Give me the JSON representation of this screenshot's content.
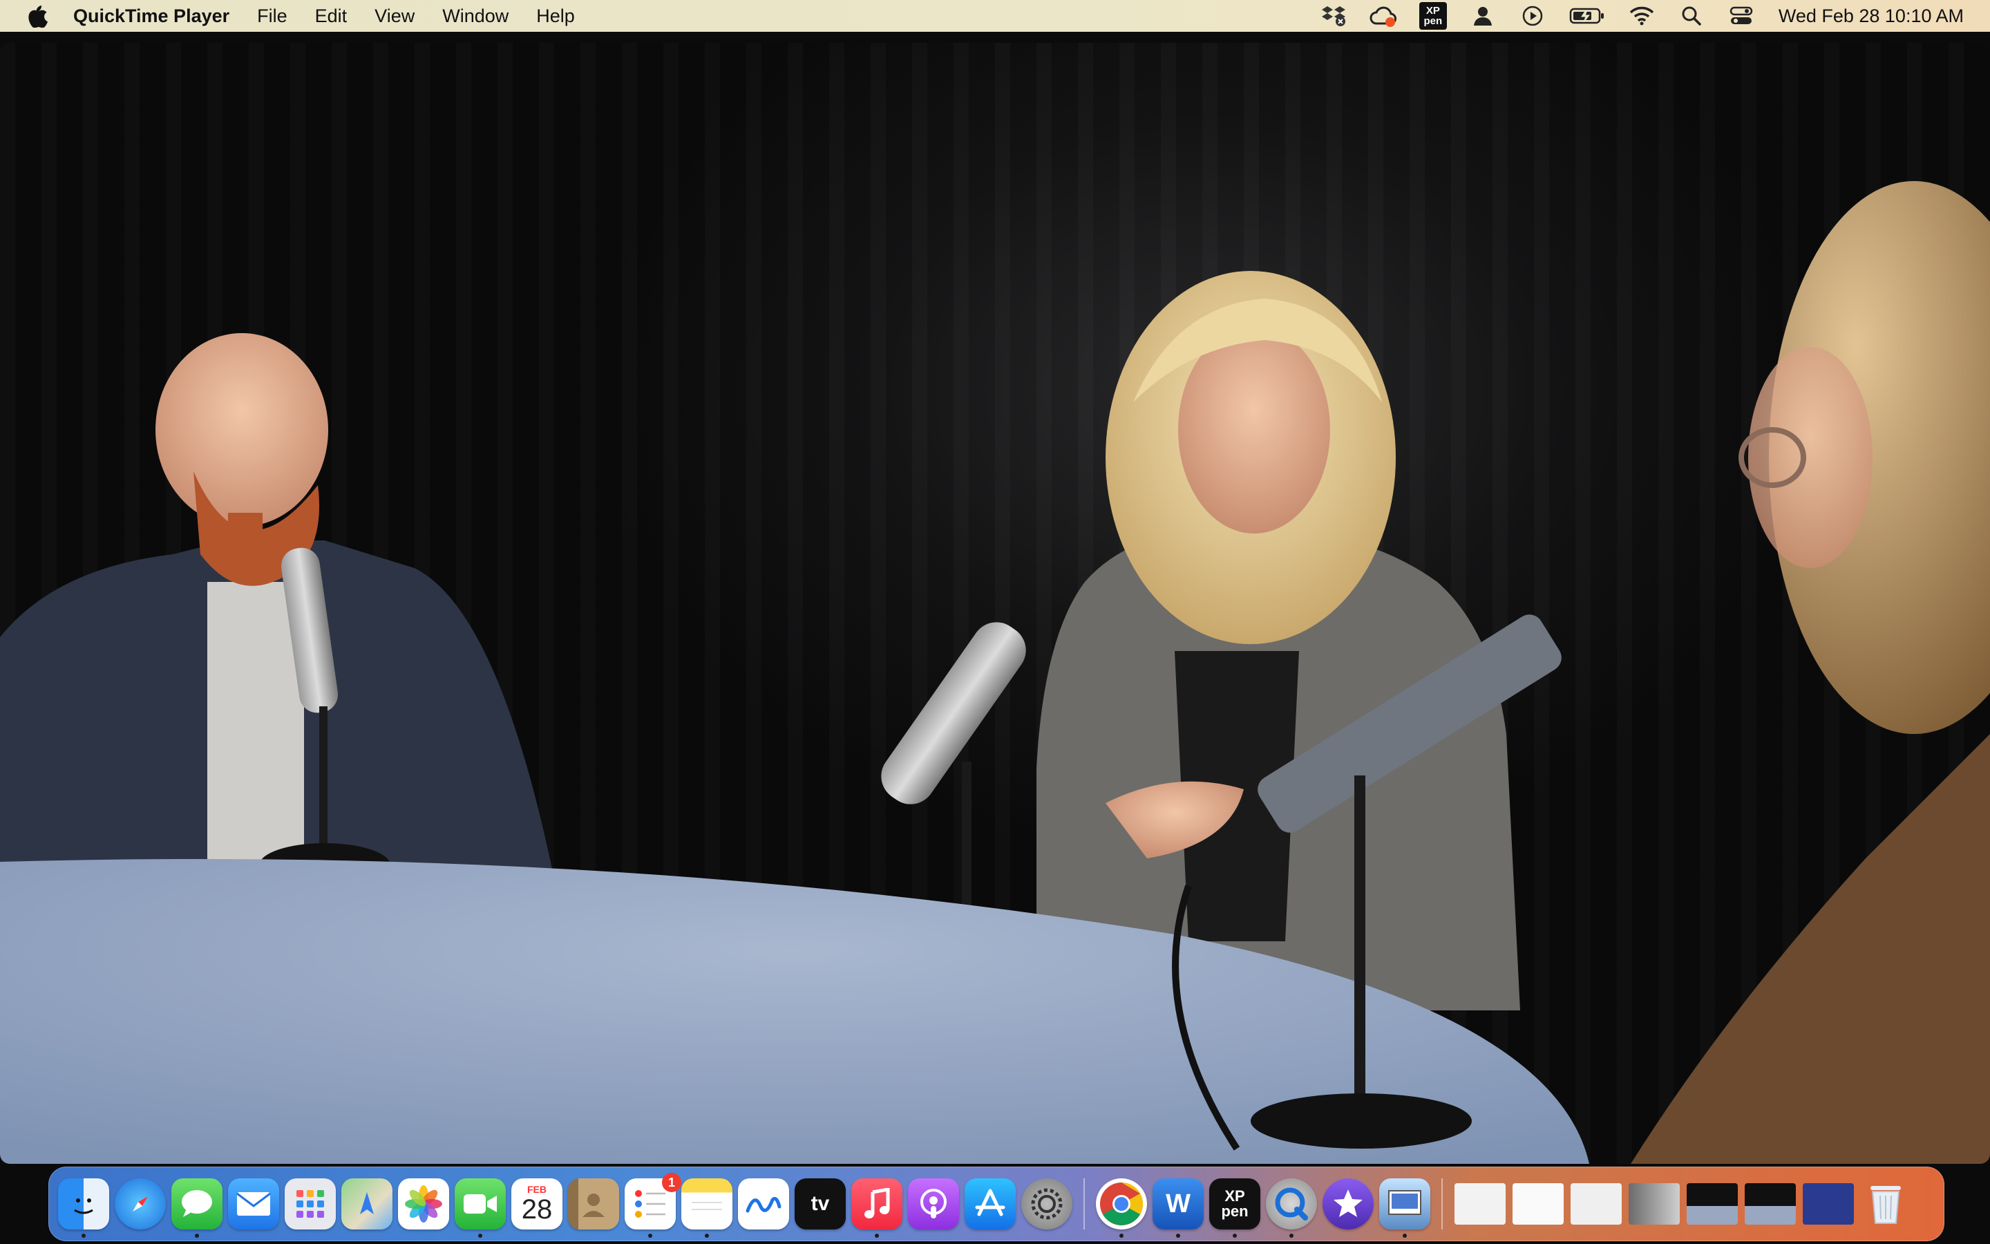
{
  "menubar": {
    "app_name": "QuickTime Player",
    "menus": [
      "File",
      "Edit",
      "View",
      "Window",
      "Help"
    ],
    "clock": "Wed Feb 28  10:10 AM",
    "xppen_label_top": "XP",
    "xppen_label_bottom": "pen"
  },
  "dock": {
    "calendar_month": "FEB",
    "calendar_day": "28",
    "reminders_badge": "1",
    "tv_label": "tv",
    "word_label": "W",
    "xppen_top": "XP",
    "xppen_bottom": "pen"
  },
  "colors": {
    "menubar_bg": "#ece6c8",
    "dock_left": "#3b73c9",
    "dock_right": "#e0683a",
    "table": "#98a9c4"
  }
}
